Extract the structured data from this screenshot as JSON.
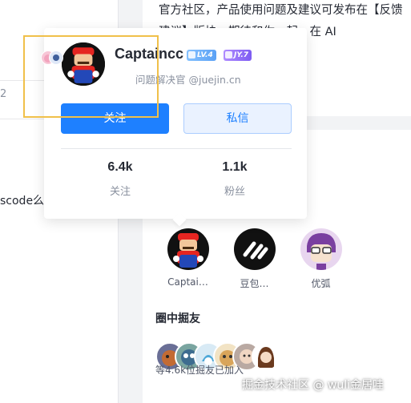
{
  "left_panel": {
    "tick_glyph": "2",
    "snippet": "scode么"
  },
  "intro_text": "官方社区，产品使用问题及建议可发布在【反馈建议】版块，期待和你一起，在 AI",
  "profile_card": {
    "username": "Captaincc",
    "level_badge": "LV.4",
    "jy_badge": "JY.7",
    "title": "问题解决官 @juejin.cn",
    "follow_label": "关注",
    "message_label": "私信",
    "stats": [
      {
        "value": "6.4k",
        "label": "关注"
      },
      {
        "value": "1.1k",
        "label": "粉丝"
      }
    ]
  },
  "follow_list": [
    {
      "name": "Captai…",
      "icon": "mario-avatar-icon"
    },
    {
      "name": "豆包…",
      "icon": "doubao-avatar-icon"
    },
    {
      "name": "优弧",
      "icon": "youhu-avatar-icon"
    }
  ],
  "friends": {
    "title": "圈中掘友",
    "count_text": "等4.6k位掘友已加入"
  },
  "watermark": "掘金技术社区 @ wuli金居哇",
  "colors": {
    "primary": "#1e80ff",
    "highlight": "#f0c04a"
  }
}
